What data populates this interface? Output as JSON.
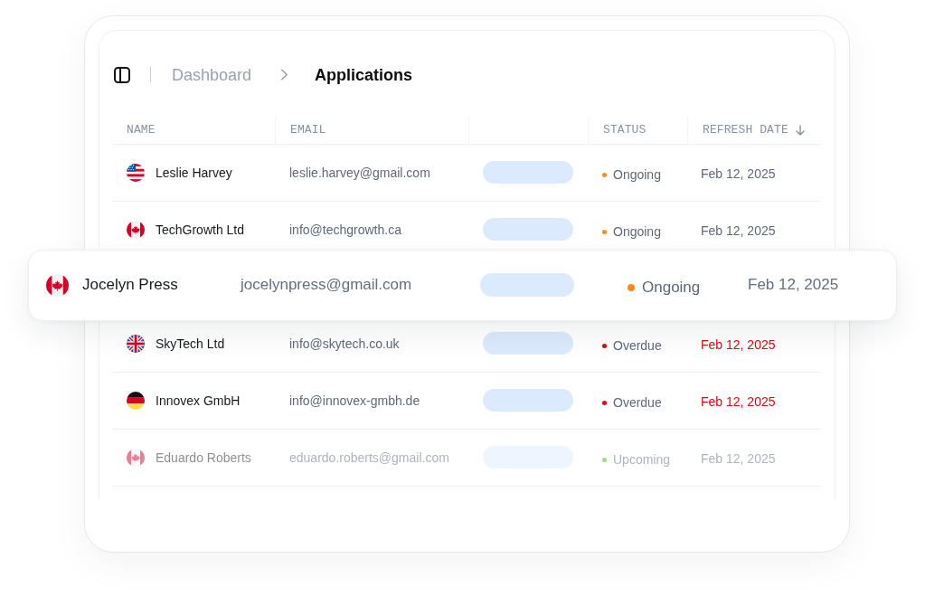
{
  "breadcrumb": {
    "items": [
      {
        "label": "Dashboard",
        "current": false
      },
      {
        "label": "Applications",
        "current": true
      }
    ]
  },
  "table": {
    "columns": [
      {
        "label": "NAME",
        "sorted": false
      },
      {
        "label": "EMAIL",
        "sorted": false
      },
      {
        "sorted": false
      },
      {
        "label": "STATUS",
        "sorted": false
      },
      {
        "label": "REFRESH DATE",
        "sorted": true
      }
    ],
    "rows": [
      {
        "flag": {
          "kind": "us"
        },
        "name": "Leslie Harvey",
        "email": "leslie.harvey@gmail.com",
        "status": {
          "label": "Ongoing",
          "color": "#f68b1f"
        },
        "date": "Feb 12, 2025",
        "overdue": false,
        "raised": false,
        "faded": false
      },
      {
        "flag": {
          "kind": "ca"
        },
        "name": "TechGrowth Ltd",
        "email": "info@techgrowth.ca",
        "status": {
          "label": "Ongoing",
          "color": "#f68b1f"
        },
        "date": "Feb 12, 2025",
        "overdue": false,
        "raised": false,
        "faded": false
      },
      {
        "flag": {
          "kind": "ca"
        },
        "name": "Jocelyn Press",
        "email": "jocelynpress@gmail.com",
        "status": {
          "label": "Ongoing",
          "color": "#f68b1f"
        },
        "date": "Feb 12, 2025",
        "overdue": false,
        "raised": true,
        "faded": false
      },
      {
        "flag": {
          "kind": "gb"
        },
        "name": "SkyTech Ltd",
        "email": "info@skytech.co.uk",
        "status": {
          "label": "Overdue",
          "color": "#e5060e"
        },
        "date": "Feb 12, 2025",
        "overdue": true,
        "raised": false,
        "faded": false
      },
      {
        "flag": {
          "kind": "de"
        },
        "name": "Innovex GmbH",
        "email": "info@innovex-gmbh.de",
        "status": {
          "label": "Overdue",
          "color": "#e5060e"
        },
        "date": "Feb 12, 2025",
        "overdue": true,
        "raised": false,
        "faded": false
      },
      {
        "flag": {
          "kind": "ca"
        },
        "name": "Eduardo Roberts",
        "email": "eduardo.roberts@gmail.com",
        "status": {
          "label": "Upcoming",
          "color": "#9bdc8b"
        },
        "date": "Feb 12, 2025",
        "overdue": false,
        "raised": false,
        "faded": true
      }
    ]
  }
}
